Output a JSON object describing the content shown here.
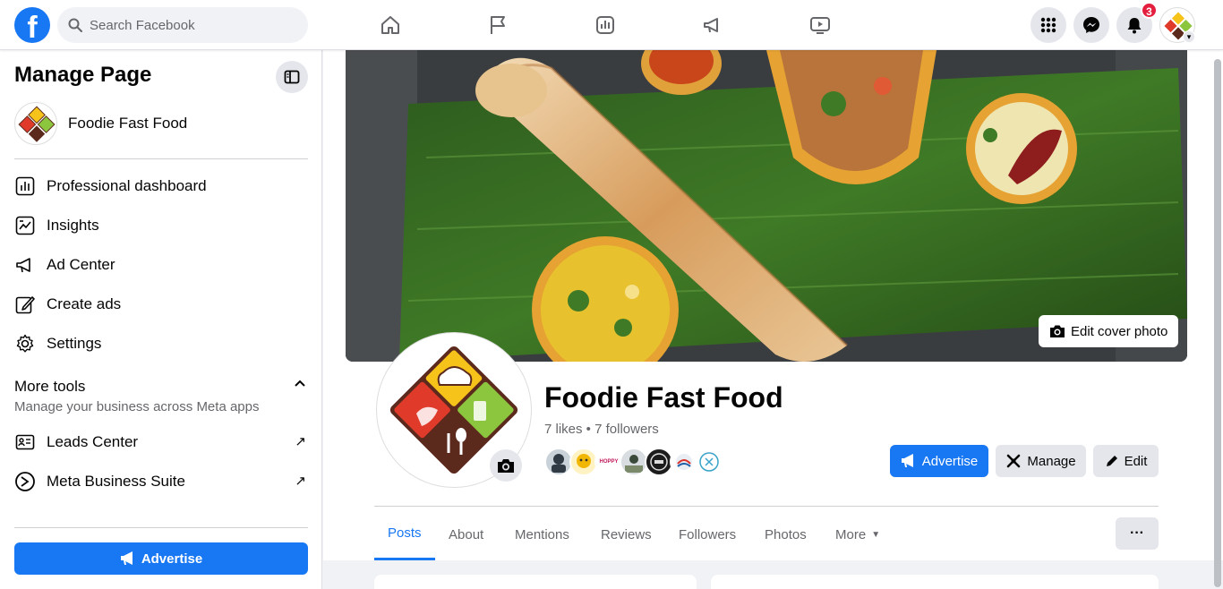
{
  "topnav": {
    "logo": "f",
    "search_placeholder": "Search Facebook",
    "notifications_count": "3",
    "nav_icons": [
      "home-icon",
      "flag-icon",
      "dashboard-icon",
      "megaphone-icon",
      "watch-icon"
    ]
  },
  "sidebar": {
    "title": "Manage Page",
    "page_name": "Foodie Fast Food",
    "items": [
      {
        "label": "Professional dashboard",
        "icon": "dashboard-icon"
      },
      {
        "label": "Insights",
        "icon": "insights-icon"
      },
      {
        "label": "Ad Center",
        "icon": "megaphone-icon"
      },
      {
        "label": "Create ads",
        "icon": "pencil-icon"
      },
      {
        "label": "Settings",
        "icon": "gear-icon"
      }
    ],
    "more_tools": {
      "title": "More tools",
      "subtitle": "Manage your business across Meta apps",
      "items": [
        {
          "label": "Leads Center",
          "icon": "id-card-icon"
        },
        {
          "label": "Meta Business Suite",
          "icon": "meta-icon"
        }
      ]
    },
    "advertise_label": "Advertise"
  },
  "profile": {
    "edit_cover_label": "Edit cover photo",
    "name": "Foodie Fast Food",
    "stats": "7 likes • 7 followers",
    "follower_text": [
      "HOPPY"
    ],
    "buttons": {
      "advertise": "Advertise",
      "manage": "Manage",
      "edit": "Edit"
    }
  },
  "tabs": [
    "Posts",
    "About",
    "Mentions",
    "Reviews",
    "Followers",
    "Photos",
    "More"
  ],
  "colors": {
    "brand_blue": "#1877f2",
    "badge_red": "#e41e3f",
    "logo_yellow": "#f6c31a",
    "logo_green": "#8cc63f",
    "logo_red": "#e03a2b",
    "logo_brown": "#5c2a1d"
  }
}
